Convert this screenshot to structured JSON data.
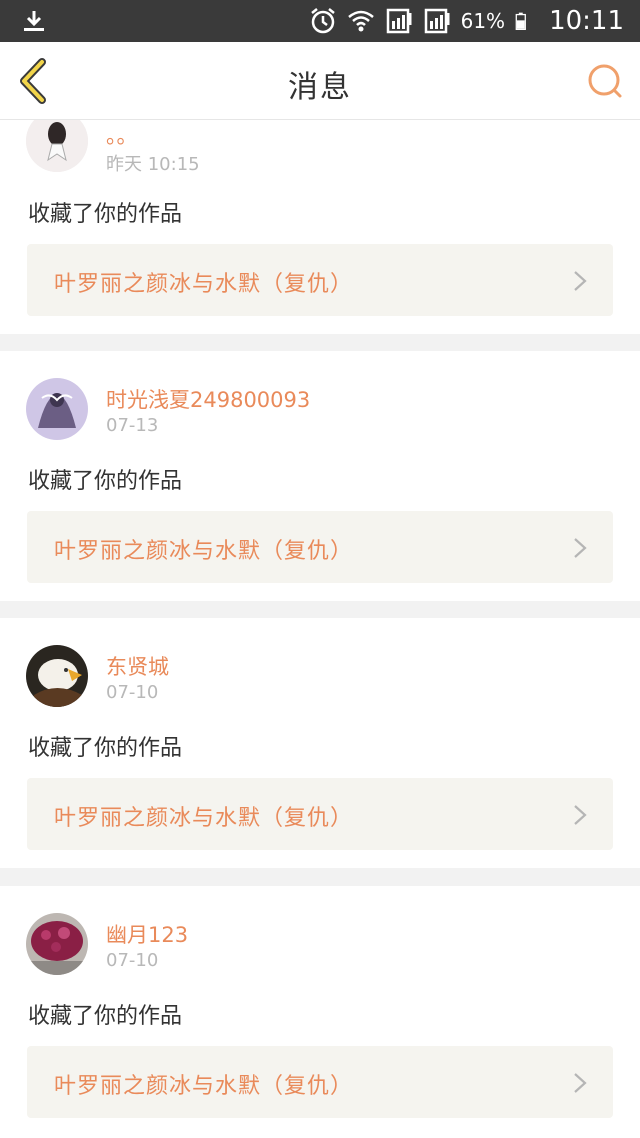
{
  "status_bar": {
    "battery": "61%",
    "time": "10:11"
  },
  "header": {
    "title": "消息"
  },
  "colors": {
    "accent": "#e98a5a",
    "work_bg": "#f5f4ef",
    "status_bar_bg": "#3a3a3a"
  },
  "messages": [
    {
      "username": "。。",
      "date": "昨天 10:15",
      "action": "收藏了你的作品",
      "work_title": "叶罗丽之颜冰与水默（复仇）"
    },
    {
      "username": "时光浅夏249800093",
      "date": "07-13",
      "action": "收藏了你的作品",
      "work_title": "叶罗丽之颜冰与水默（复仇）"
    },
    {
      "username": "东贤城",
      "date": "07-10",
      "action": "收藏了你的作品",
      "work_title": "叶罗丽之颜冰与水默（复仇）"
    },
    {
      "username": "幽月123",
      "date": "07-10",
      "action": "收藏了你的作品",
      "work_title": "叶罗丽之颜冰与水默（复仇）"
    }
  ]
}
